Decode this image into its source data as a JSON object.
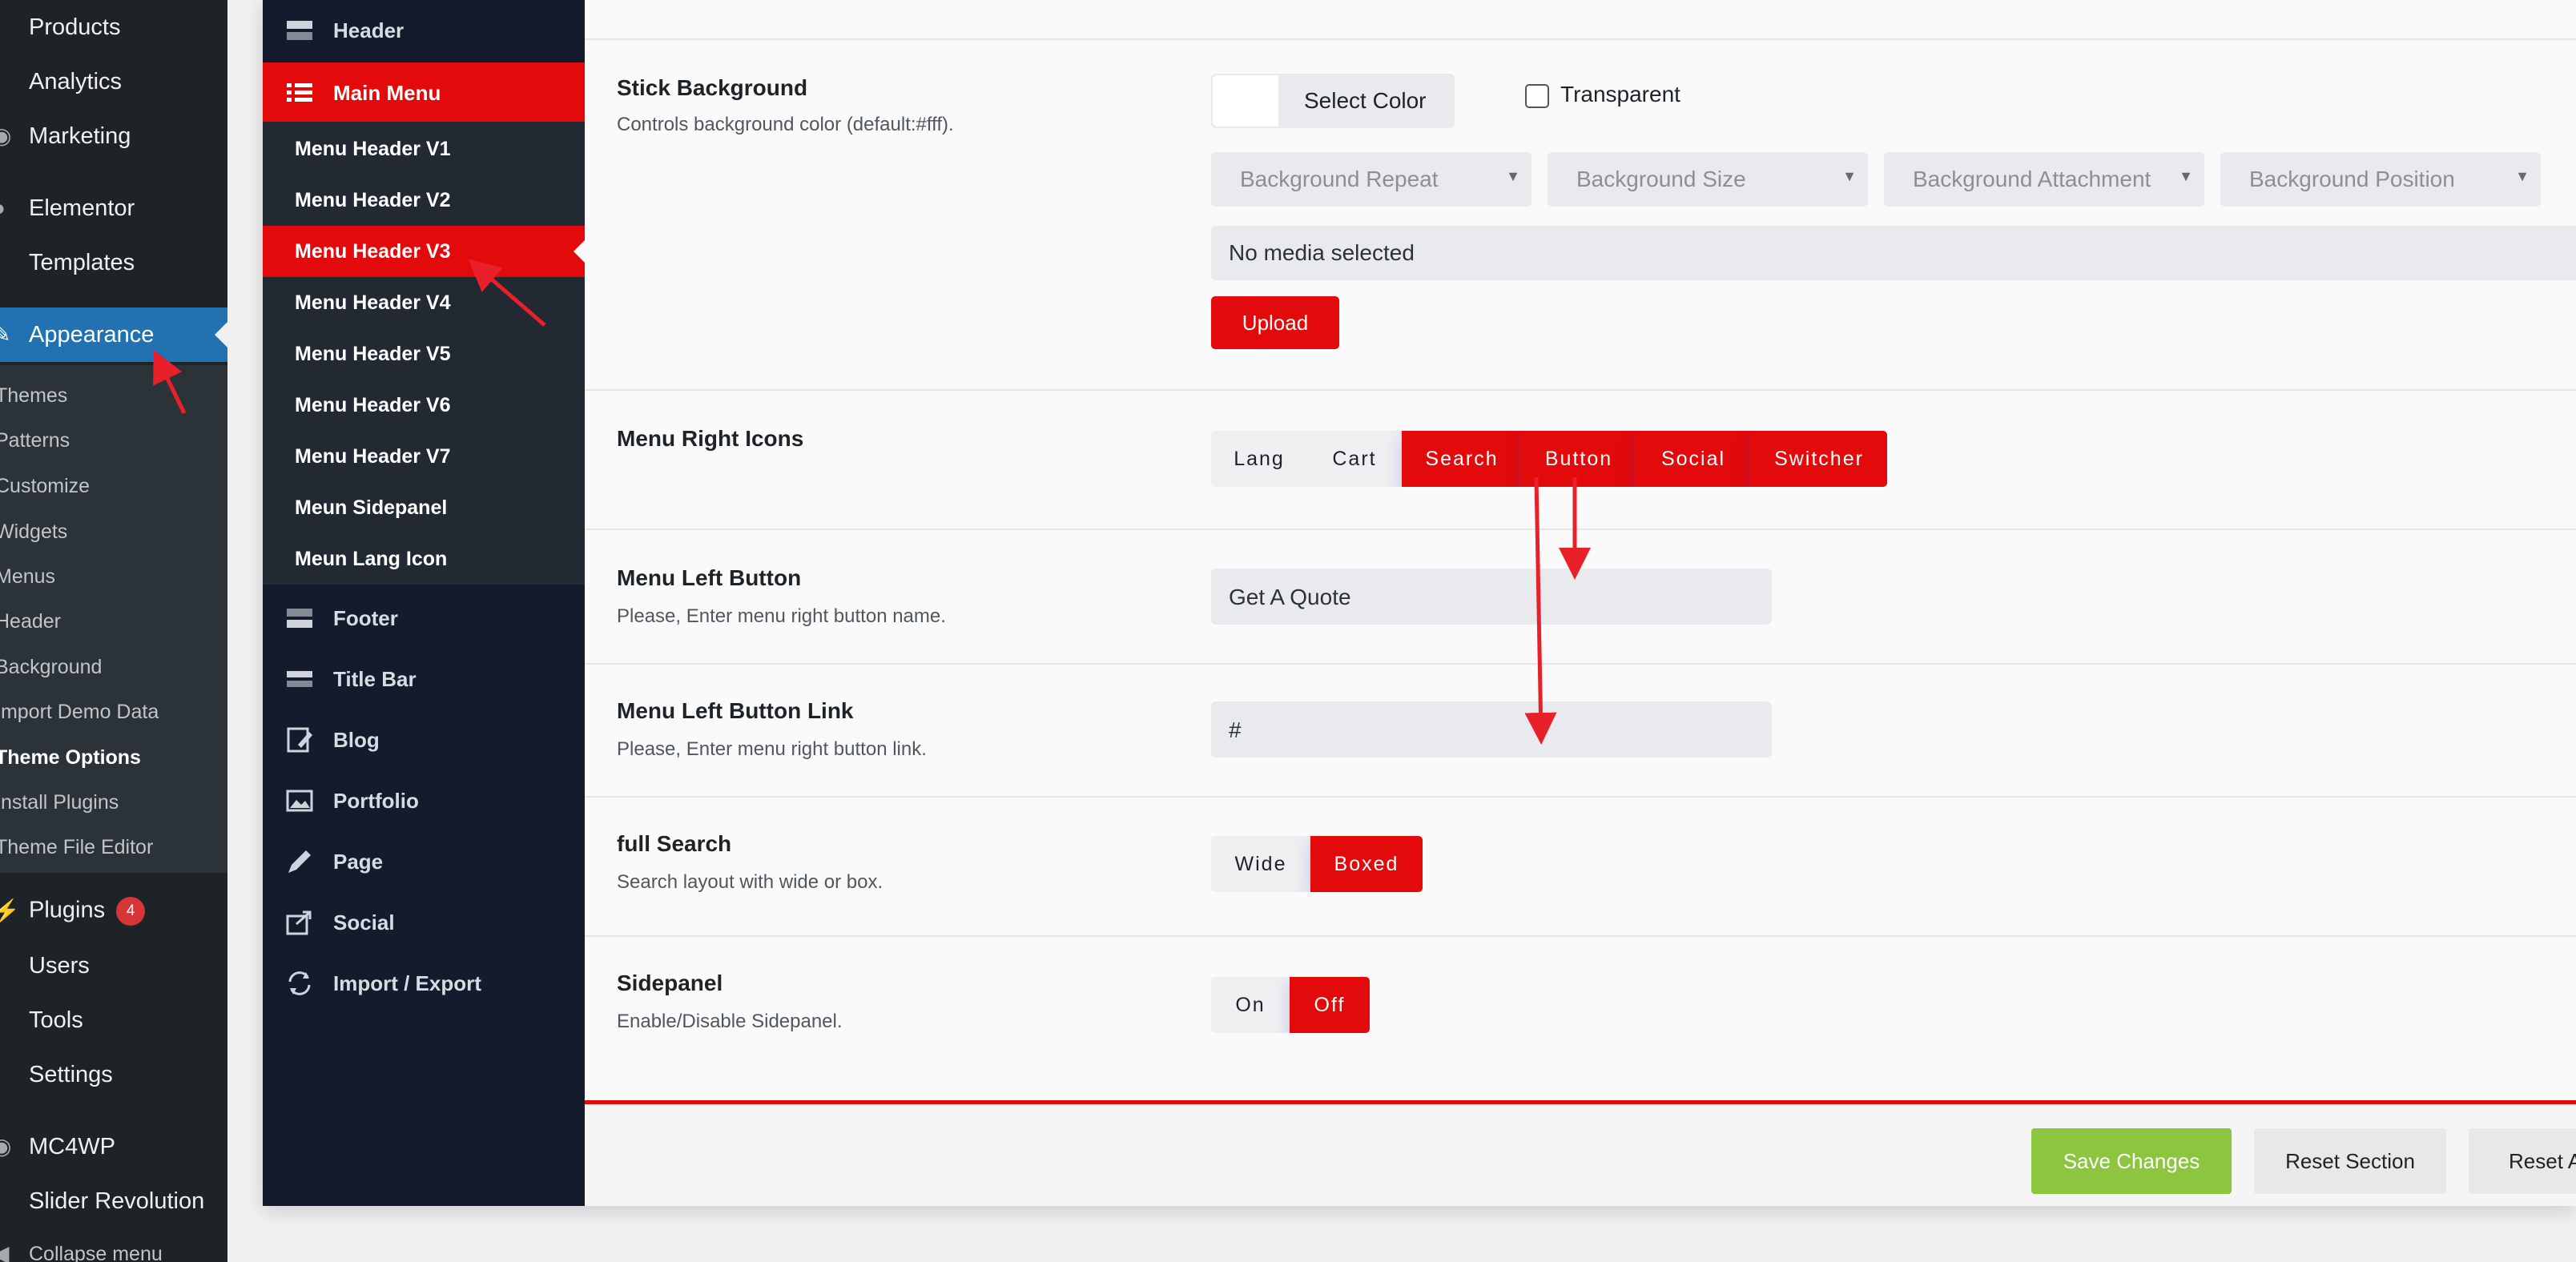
{
  "wp_menu": {
    "items_top": [
      {
        "label": "Products",
        "icon": "products-icon"
      },
      {
        "label": "Analytics",
        "icon": "analytics-icon"
      },
      {
        "label": "Marketing",
        "icon": "marketing-icon"
      },
      {
        "label": "Elementor",
        "icon": "elementor-icon"
      },
      {
        "label": "Templates",
        "icon": "templates-icon"
      },
      {
        "label": "Appearance",
        "icon": "paintbrush-icon",
        "active": true
      }
    ],
    "appearance_submenu": [
      "Themes",
      "Patterns",
      "Customize",
      "Widgets",
      "Menus",
      "Header",
      "Background",
      "Import Demo Data",
      "Theme Options",
      "Install Plugins",
      "Theme File Editor"
    ],
    "current_submenu": "Theme Options",
    "items_bottom": [
      {
        "label": "Plugins",
        "icon": "plugins-icon",
        "badge": "4"
      },
      {
        "label": "Users",
        "icon": "users-icon"
      },
      {
        "label": "Tools",
        "icon": "tools-icon"
      },
      {
        "label": "Settings",
        "icon": "settings-icon"
      },
      {
        "label": "MC4WP",
        "icon": "mc4wp-icon"
      },
      {
        "label": "Slider Revolution",
        "icon": "slider-icon"
      },
      {
        "label": "Collapse menu",
        "icon": "collapse-icon"
      }
    ]
  },
  "options_nav": {
    "header": "Header",
    "main_menu": "Main Menu",
    "main_menu_items": [
      "Menu Header V1",
      "Menu Header V2",
      "Menu Header V3",
      "Menu Header V4",
      "Menu Header V5",
      "Menu Header V6",
      "Menu Header V7",
      "Meun Sidepanel",
      "Meun Lang Icon"
    ],
    "active_item": "Menu Header V3",
    "footer": "Footer",
    "title_bar": "Title Bar",
    "blog": "Blog",
    "portfolio": "Portfolio",
    "page": "Page",
    "social": "Social",
    "import_export": "Import / Export"
  },
  "stick_background": {
    "title": "Stick Background",
    "desc": "Controls background color (default:#fff).",
    "select_color": "Select Color",
    "transparent": "Transparent",
    "selects": [
      "Background Repeat",
      "Background Size",
      "Background Attachment",
      "Background Position"
    ],
    "media": "No media selected",
    "upload": "Upload"
  },
  "menu_right_icons": {
    "title": "Menu Right Icons",
    "options": [
      {
        "label": "Lang",
        "on": false
      },
      {
        "label": "Cart",
        "on": false
      },
      {
        "label": "Search",
        "on": true
      },
      {
        "label": "Button",
        "on": true
      },
      {
        "label": "Social",
        "on": true
      },
      {
        "label": "Switcher",
        "on": true
      }
    ]
  },
  "menu_left_button": {
    "title": "Menu Left Button",
    "desc": "Please, Enter menu right button name.",
    "value": "Get A Quote"
  },
  "menu_left_button_link": {
    "title": "Menu Left Button Link",
    "desc": "Please, Enter menu right button link.",
    "value": "#"
  },
  "full_search": {
    "title": "full Search",
    "desc": "Search layout with wide or box.",
    "options": [
      {
        "label": "Wide",
        "on": false
      },
      {
        "label": "Boxed",
        "on": true
      }
    ]
  },
  "sidepanel": {
    "title": "Sidepanel",
    "desc": "Enable/Disable Sidepanel.",
    "options": [
      {
        "label": "On",
        "on": false
      },
      {
        "label": "Off",
        "on": true
      }
    ]
  },
  "footer_buttons": {
    "save": "Save Changes",
    "reset_section": "Reset Section",
    "reset_all": "Reset Al"
  },
  "colors": {
    "accent_red": "#e20a0a",
    "save_green": "#8cc63f",
    "wp_blue": "#2271b1",
    "nav_dark": "#131b2c"
  }
}
